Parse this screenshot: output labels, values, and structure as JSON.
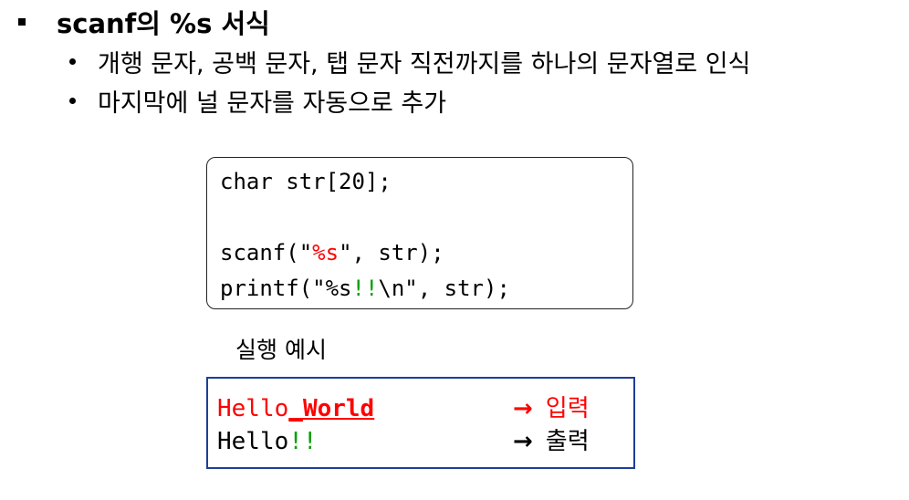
{
  "heading": {
    "title": "scanf의 %s 서식"
  },
  "bullets": [
    {
      "text": "개행 문자, 공백 문자, 탭 문자 직전까지를 하나의 문자열로 인식"
    },
    {
      "text": "마지막에 널 문자를 자동으로 추가"
    }
  ],
  "code": {
    "line1": "char str[20];",
    "line3_pre": "scanf(\"",
    "line3_fmt": "%s",
    "line3_post": "\", str);",
    "line4_pre": "printf(\"%s",
    "line4_bang": "!!",
    "line4_post": "\\n\", str);"
  },
  "caption": "실행 예시",
  "run": {
    "input_plain": "Hello",
    "input_underscore": "_",
    "input_bold": "World",
    "input_label": "입력",
    "output_plain": "Hello",
    "output_bang": "!!",
    "output_label": "출력",
    "arrow": "→"
  },
  "colors": {
    "highlight_red": "#ff0000",
    "highlight_green": "#00a000",
    "run_box_border": "#1f3d99"
  }
}
